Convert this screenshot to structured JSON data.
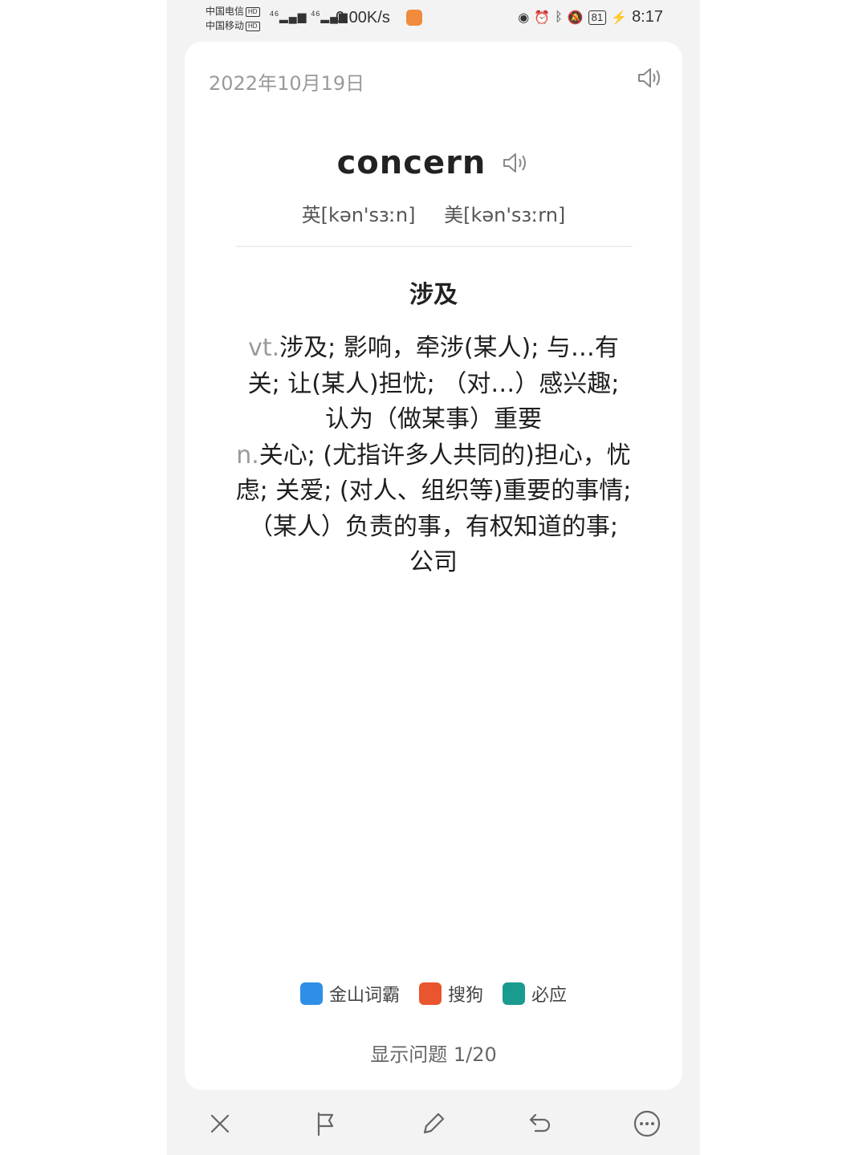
{
  "status_bar": {
    "carrier1": "中国电信",
    "carrier2": "中国移动",
    "hd_badge": "HD",
    "signal1": "46",
    "signal2": "46",
    "net_speed": "0.00K/s",
    "battery": "81",
    "time": "8:17"
  },
  "card": {
    "date": "2022年10月19日",
    "word": "concern",
    "phonetic_uk": "英[kən'sɜːn]",
    "phonetic_us": "美[kən'sɜːrn]",
    "meaning": "涉及",
    "definitions": [
      {
        "pos": "vt.",
        "text": "涉及; 影响，牵涉(某人); 与…有关; 让(某人)担忧; （对…）感兴趣; 认为（做某事）重要"
      },
      {
        "pos": "n.",
        "text": "关心; (尤指许多人共同的)担心，忧虑; 关爱; (对人、组织等)重要的事情; （某人）负责的事，有权知道的事; 公司"
      }
    ],
    "dictionaries": [
      {
        "label": "金山词霸",
        "color": "#2f8fe6"
      },
      {
        "label": "搜狗",
        "color": "#e8552f"
      },
      {
        "label": "必应",
        "color": "#1a9b8f"
      }
    ],
    "show_question": "显示问题 1/20"
  },
  "toolbar": {
    "icons": [
      "close-icon",
      "flag-icon",
      "edit-icon",
      "undo-icon",
      "more-icon"
    ]
  }
}
